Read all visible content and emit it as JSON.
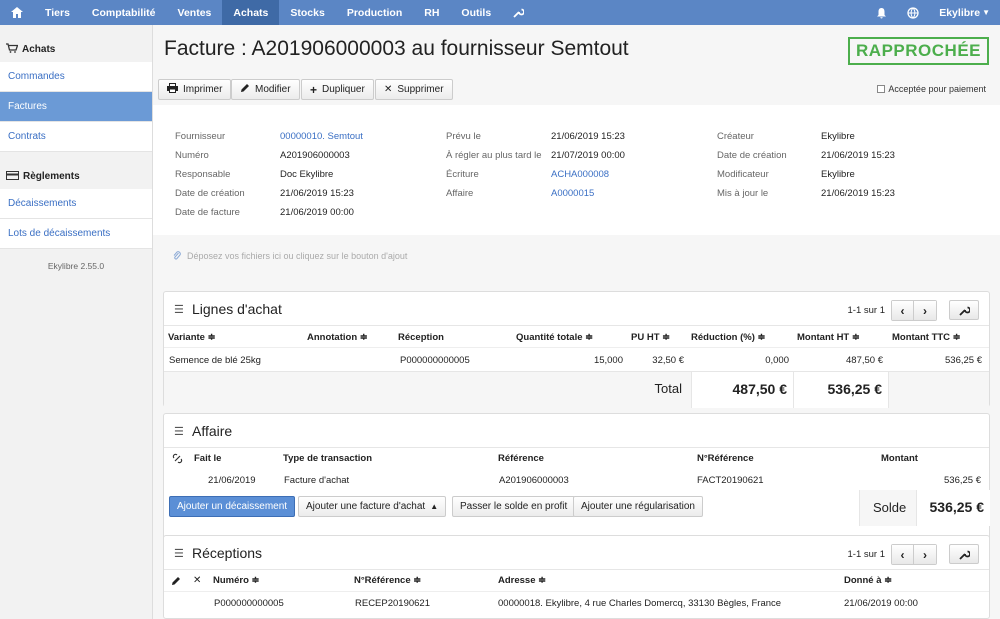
{
  "topnav": {
    "home_icon": "home-icon",
    "items": [
      "Tiers",
      "Comptabilité",
      "Ventes",
      "Achats",
      "Stocks",
      "Production",
      "RH",
      "Outils"
    ],
    "active": "Achats",
    "user": "Ekylibre"
  },
  "sidebar": {
    "section1": "Achats",
    "section1_items": [
      "Commandes",
      "Factures",
      "Contrats"
    ],
    "section2": "Règlements",
    "section2_items": [
      "Décaissements",
      "Lots de décaissements"
    ],
    "version": "Ekylibre 2.55.0"
  },
  "header": {
    "title": "Facture : A201906000003 au fournisseur Semtout",
    "status": "RAPPROCHÉE"
  },
  "toolbar": {
    "print": "Imprimer",
    "edit": "Modifier",
    "duplicate": "Dupliquer",
    "delete": "Supprimer",
    "accept_label": "Acceptée pour paiement"
  },
  "details": {
    "col1": [
      {
        "label": "Fournisseur",
        "value": "00000010. Semtout"
      },
      {
        "label": "Numéro",
        "value": "A201906000003"
      },
      {
        "label": "Responsable",
        "value": "Doc Ekylibre"
      },
      {
        "label": "Date de création",
        "value": "21/06/2019 15:23"
      },
      {
        "label": "Date de facture",
        "value": "21/06/2019 00:00"
      }
    ],
    "col2": [
      {
        "label": "Prévu le",
        "value": "21/06/2019 15:23"
      },
      {
        "label": "À régler au plus tard le",
        "value": "21/07/2019 00:00"
      },
      {
        "label": "Écriture",
        "value": "ACHA000008"
      },
      {
        "label": "Affaire",
        "value": "A0000015"
      }
    ],
    "col3": [
      {
        "label": "Créateur",
        "value": "Ekylibre"
      },
      {
        "label": "Date de création",
        "value": "21/06/2019 15:23"
      },
      {
        "label": "Modificateur",
        "value": "Ekylibre"
      },
      {
        "label": "Mis à jour le",
        "value": "21/06/2019 15:23"
      }
    ]
  },
  "dropzone": {
    "text": "Déposez vos fichiers ici ou cliquez sur le bouton d'ajout"
  },
  "lignes": {
    "title": "Lignes d'achat",
    "pager": "1-1 sur 1",
    "headers": [
      "Variante ≑",
      "Annotation ≑",
      "Réception",
      "Quantité totale ≑",
      "PU HT ≑",
      "Réduction (%) ≑",
      "Montant HT ≑",
      "Montant TTC ≑"
    ],
    "row": {
      "variante": "Semence de blé 25kg",
      "reception": "P000000000005",
      "quantite": "15,000",
      "pu_ht": "32,50 €",
      "reduction": "0,000",
      "montant_ht": "487,50 €",
      "montant_ttc": "536,25 €"
    },
    "total_label": "Total",
    "total_ht": "487,50 €",
    "total_ttc": "536,25 €"
  },
  "affaire": {
    "title": "Affaire",
    "headers": [
      "Fait le",
      "Type de transaction",
      "Référence",
      "N°Référence",
      "Montant"
    ],
    "row": {
      "date": "21/06/2019",
      "type": "Facture d'achat",
      "reference": "A201906000003",
      "n_reference": "FACT20190621",
      "montant": "536,25 €"
    },
    "btn_decaissement": "Ajouter un décaissement",
    "btn_facture": "Ajouter une facture d'achat",
    "btn_solde": "Passer le solde en profit",
    "btn_regularisation": "Ajouter une régularisation",
    "solde_label": "Solde",
    "solde_value": "536,25 €"
  },
  "receptions": {
    "title": "Réceptions",
    "pager": "1-1 sur 1",
    "headers": [
      "Numéro ≑",
      "N°Référence ≑",
      "Adresse ≑",
      "Donné à ≑"
    ],
    "row": {
      "numero": "P000000000005",
      "n_reference": "RECEP20190621",
      "adresse": "00000018. Ekylibre, 4 rue Charles Domercq, 33130 Bègles, France",
      "donne_a": "21/06/2019 00:00"
    }
  }
}
